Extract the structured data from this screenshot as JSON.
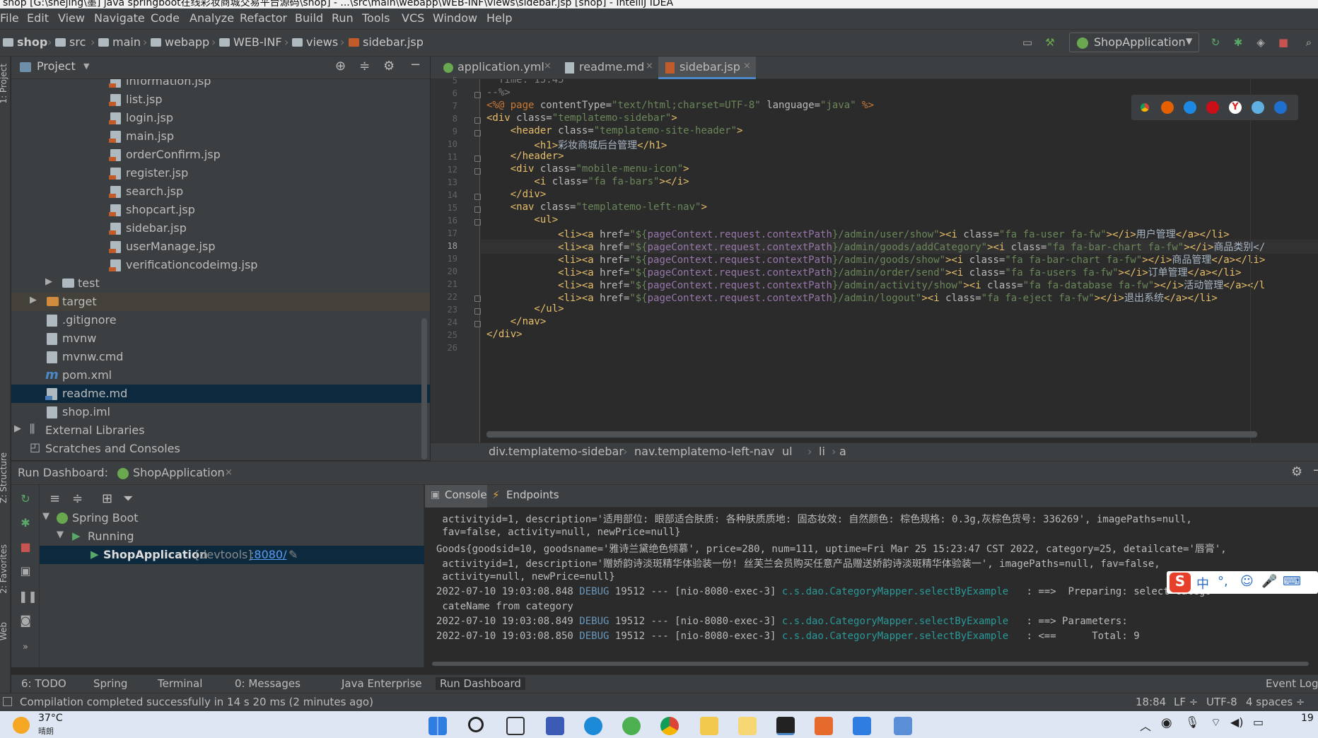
{
  "window": {
    "title": "shop [G:\\shejing\\墨] java springboot在线彩妆商城交易平台源码\\shop] - ...\\src\\main\\webapp\\WEB-INF\\views\\sidebar.jsp [shop] - IntelliJ IDEA"
  },
  "menu": [
    "File",
    "Edit",
    "View",
    "Navigate",
    "Code",
    "Analyze",
    "Refactor",
    "Build",
    "Run",
    "Tools",
    "VCS",
    "Window",
    "Help"
  ],
  "breadcrumb": [
    "shop",
    "src",
    "main",
    "webapp",
    "WEB-INF",
    "views",
    "sidebar.jsp"
  ],
  "run_config": {
    "label": "ShopApplication"
  },
  "project_panel": {
    "title": "Project",
    "side_label": "1: Project"
  },
  "tree": [
    {
      "name": "information.jsp",
      "type": "jsp"
    },
    {
      "name": "list.jsp",
      "type": "jsp"
    },
    {
      "name": "login.jsp",
      "type": "jsp"
    },
    {
      "name": "main.jsp",
      "type": "jsp"
    },
    {
      "name": "orderConfirm.jsp",
      "type": "jsp"
    },
    {
      "name": "register.jsp",
      "type": "jsp"
    },
    {
      "name": "search.jsp",
      "type": "jsp"
    },
    {
      "name": "shopcart.jsp",
      "type": "jsp"
    },
    {
      "name": "sidebar.jsp",
      "type": "jsp"
    },
    {
      "name": "userManage.jsp",
      "type": "jsp"
    },
    {
      "name": "verificationcodeimg.jsp",
      "type": "jsp"
    },
    {
      "name": "test",
      "type": "folder"
    },
    {
      "name": "target",
      "type": "folder-orange"
    },
    {
      "name": ".gitignore",
      "type": "file"
    },
    {
      "name": "mvnw",
      "type": "file"
    },
    {
      "name": "mvnw.cmd",
      "type": "file"
    },
    {
      "name": "pom.xml",
      "type": "maven"
    },
    {
      "name": "readme.md",
      "type": "md"
    },
    {
      "name": "shop.iml",
      "type": "file"
    },
    {
      "name": "External Libraries",
      "type": "lib"
    },
    {
      "name": "Scratches and Consoles",
      "type": "scratch"
    }
  ],
  "tabs": [
    {
      "label": "application.yml",
      "close": "×"
    },
    {
      "label": "readme.md",
      "close": "×"
    },
    {
      "label": "sidebar.jsp",
      "close": "×"
    }
  ],
  "line_numbers": [
    "5",
    "6",
    "7",
    "8",
    "9",
    "10",
    "11",
    "12",
    "13",
    "14",
    "15",
    "16",
    "17",
    "18",
    "19",
    "20",
    "21",
    "22",
    "23",
    "24",
    "25",
    "26"
  ],
  "code": {
    "l5": "  Time: 15:45",
    "l6": "--%>",
    "l7a": "<%@ ",
    "l7b": "page ",
    "l7c": "contentType=",
    "l7d": "\"text/html;charset=UTF-8\" ",
    "l7e": "language=",
    "l7f": "\"java\"",
    "l7g": " %>",
    "l8a": "<div ",
    "l8b": "class=",
    "l8c": "\"templatemo-sidebar\"",
    "l8d": ">",
    "l9a": "    <header ",
    "l9b": "class=",
    "l9c": "\"templatemo-site-header\"",
    "l9d": ">",
    "l10a": "        <h1>",
    "l10b": "彩妆商城后台管理",
    "l10c": "</h1>",
    "l11": "    </header>",
    "l12a": "    <div ",
    "l12b": "class=",
    "l12c": "\"mobile-menu-icon\"",
    "l12d": ">",
    "l13a": "        <i ",
    "l13b": "class=",
    "l13c": "\"fa fa-bars\"",
    "l13d": "></i>",
    "l14": "    </div>",
    "l15a": "    <nav ",
    "l15b": "class=",
    "l15c": "\"templatemo-left-nav\"",
    "l15d": ">",
    "l16": "        <ul>",
    "l17a": "            <li><a ",
    "l17b": "href=",
    "l17c": "\"${",
    "l17d": "pageContext.request.contextPath",
    "l17e": "}/admin/user/show\"",
    "l17f": "><i ",
    "l17g": "class=",
    "l17h": "\"fa fa-user fa-fw\"",
    "l17i": "></i>",
    "l17j": "用户管理",
    "l17k": "</a></li>",
    "l18a": "            <li><a ",
    "l18b": "href=",
    "l18c": "\"${",
    "l18d": "pageContext.request.contextPath",
    "l18e": "}/admin/goods/addCategory\"",
    "l18f": "><i ",
    "l18g": "class=",
    "l18h": "\"fa fa-bar-chart fa-fw\"",
    "l18i": "></i>",
    "l18j": "商品类别</",
    "l19a": "            <li><a ",
    "l19b": "href=",
    "l19c": "\"${",
    "l19d": "pageContext.request.contextPath",
    "l19e": "}/admin/goods/show\"",
    "l19f": "><i ",
    "l19g": "class=",
    "l19h": "\"fa fa-bar-chart fa-fw\"",
    "l19i": "></i>",
    "l19j": "商品管理",
    "l19k": "</a></li>",
    "l20a": "            <li><a ",
    "l20b": "href=",
    "l20c": "\"${",
    "l20d": "pageContext.request.contextPath",
    "l20e": "}/admin/order/send\"",
    "l20f": "><i ",
    "l20g": "class=",
    "l20h": "\"fa fa-users fa-fw\"",
    "l20i": "></i>",
    "l20j": "订单管理",
    "l20k": "</a></li>",
    "l21a": "            <li><a ",
    "l21b": "href=",
    "l21c": "\"${",
    "l21d": "pageContext.request.contextPath",
    "l21e": "}/admin/activity/show\"",
    "l21f": "><i ",
    "l21g": "class=",
    "l21h": "\"fa fa-database fa-fw\"",
    "l21i": "></i>",
    "l21j": "活动管理",
    "l21k": "</a></l",
    "l22a": "            <li><a ",
    "l22b": "href=",
    "l22c": "\"${",
    "l22d": "pageContext.request.contextPath",
    "l22e": "}/admin/logout\"",
    "l22f": "><i ",
    "l22g": "class=",
    "l22h": "\"fa fa-eject fa-fw\"",
    "l22i": "></i>",
    "l22j": "退出系统",
    "l22k": "</a></li>",
    "l23": "        </ul>",
    "l24": "    </nav>",
    "l25": "</div>"
  },
  "editor_breadcrumb": [
    "div.templatemo-sidebar",
    "nav.templatemo-left-nav",
    "ul",
    "li",
    "a"
  ],
  "run_dashboard": {
    "label": "Run Dashboard:",
    "app_tab": "ShopApplication",
    "close": "×",
    "settings_icon": "gear-icon"
  },
  "run_tree": {
    "spring_boot": "Spring Boot",
    "running": "Running",
    "app": "ShopApplication",
    "devtools": "[devtools]",
    "port": ":8080/"
  },
  "console_tabs": [
    "Console",
    "Endpoints"
  ],
  "console": {
    "c1": " activityid=1, description='适用部位: 眼部适合肤质: 各种肤质质地: 固态妆效: 自然颜色: 棕色规格: 0.3g,灰棕色货号: 336269', imagePaths=null,",
    "c2": " fav=false, activity=null, newPrice=null}",
    "c3": "Goods{goodsid=10, goodsname='雅诗兰黛绝色倾慕', price=280, num=111, uptime=Fri Mar 25 15:23:47 CST 2022, category=25, detailcate='唇膏',",
    "c4": " activityid=1, description='赠娇韵诗淡斑精华体验装一份! 丝芙兰会员购买任意产品赠送娇韵诗淡斑精华体验装一', imagePaths=null, fav=false,",
    "c5": " activity=null, newPrice=null}",
    "c6a": "2022-07-10 19:03:08.848 ",
    "c6b": "DEBUG",
    "c6c": " 19512 --- [nio-8080-exec-3] ",
    "c6d": "c.s.dao.CategoryMapper.selectByExample",
    "c6e": "   : ==>  Preparing: select catego",
    "c7": " cateName from category",
    "c8a": "2022-07-10 19:03:08.849 ",
    "c8b": "DEBUG",
    "c8c": " 19512 --- [nio-8080-exec-3] ",
    "c8d": "c.s.dao.CategoryMapper.selectByExample",
    "c8e": "   : ==> Parameters: ",
    "c9a": "2022-07-10 19:03:08.850 ",
    "c9b": "DEBUG",
    "c9c": " 19512 --- [nio-8080-exec-3] ",
    "c9d": "c.s.dao.CategoryMapper.selectByExample",
    "c9e": "   : <==      Total: 9"
  },
  "ime": {
    "logo": "S",
    "items": [
      "中",
      "°,",
      "☺",
      "🎤",
      "⌨"
    ]
  },
  "bottom_tabs": [
    "6: TODO",
    "Spring",
    "Terminal",
    "0: Messages",
    "Java Enterprise",
    "Run Dashboard",
    "Event Log"
  ],
  "side_labels": [
    "Z: Structure",
    "2: Favorites",
    "Web"
  ],
  "status": {
    "message": "Compilation completed successfully in 14 s 20 ms (2 minutes ago)",
    "position": "18:84",
    "line_sep": "LF ÷",
    "encoding": "UTF-8",
    "indent": "4 spaces ÷"
  },
  "taskbar": {
    "temp": "37°C",
    "weather": "晴朗",
    "time": "19"
  },
  "colors": {
    "accent": "#4a88c7",
    "selection": "#0d293e",
    "editor_bg": "#2b2b2b",
    "panel_bg": "#3c3f41"
  }
}
